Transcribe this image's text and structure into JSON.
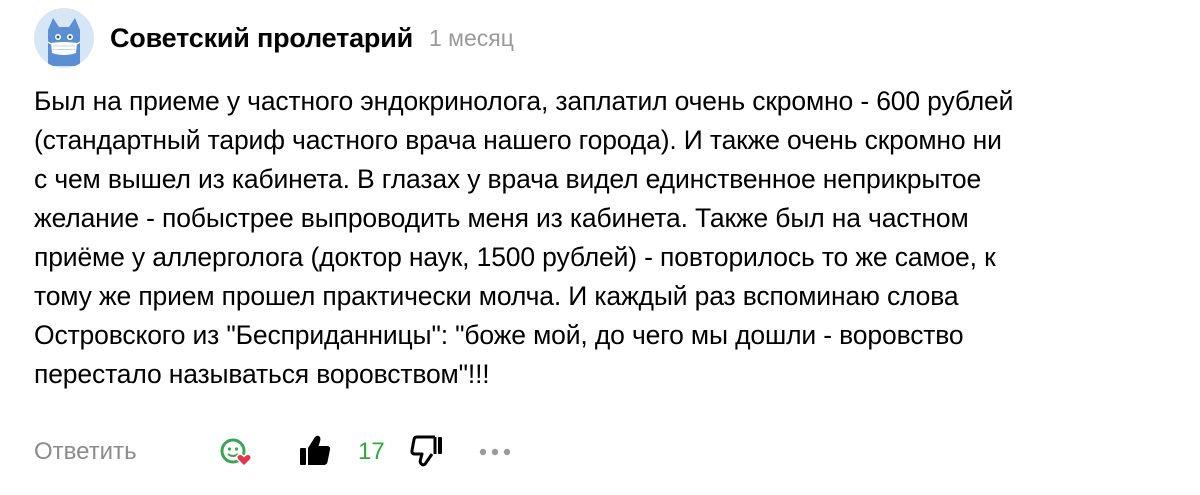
{
  "comment": {
    "author": "Советский пролетарий",
    "time": "1 месяц",
    "text_lines": [
      "Был на приеме у частного эндокринолога, заплатил очень скромно - 600 рублей",
      "(стандартный тариф частного врача нашего города). И также очень скромно ни",
      "с чем вышел из кабинета. В глазах у врача видел единственное неприкрытое",
      "желание - побыстрее выпроводить меня из кабинета. Также был на частном",
      "приёме у аллерголога (доктор наук, 1500 рублей) - повторилось то же самое, к",
      "тому же прием прошел практически молча. И каждый раз вспоминаю слова",
      "Островского из \"Бесприданницы\": \"боже мой, до чего мы дошли - воровство",
      "перестало называться воровством\"!!!"
    ]
  },
  "actions": {
    "reply_label": "Ответить",
    "like_count": "17"
  },
  "icons": {
    "avatar": "cat-mask-avatar-icon",
    "reaction": "reaction-heart-icon",
    "like": "thumbs-up-icon",
    "dislike": "thumbs-down-icon",
    "more": "more-dots-icon"
  },
  "colors": {
    "author_text": "#000000",
    "time_text": "#9a9a9a",
    "reply_text": "#8c8c8c",
    "like_count": "#2eac3a",
    "reaction_green": "#3aa655",
    "reaction_heart": "#e8334a",
    "avatar_bg": "#d7e6f4",
    "avatar_cat": "#5b8fd3"
  }
}
